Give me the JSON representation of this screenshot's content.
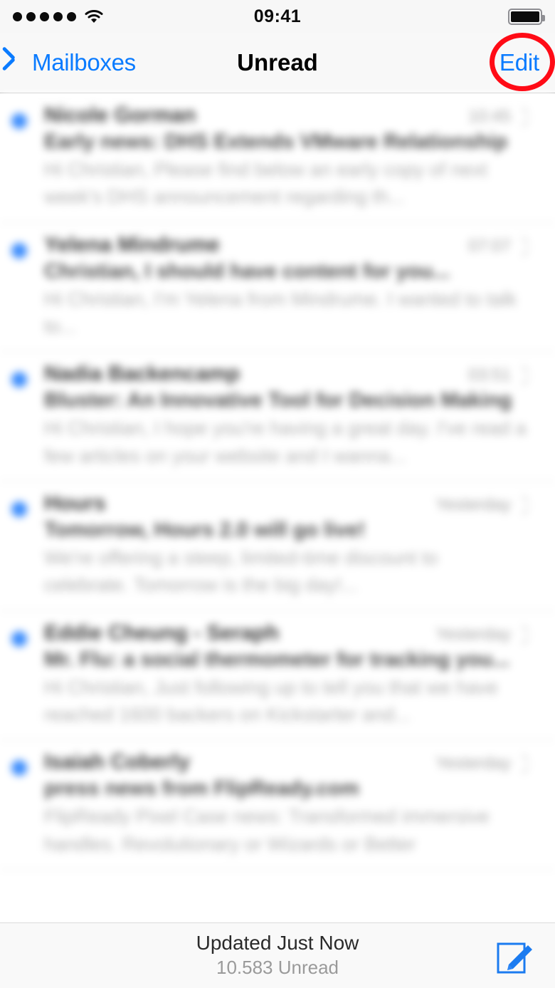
{
  "status_bar": {
    "signal_dots": 5,
    "wifi_icon": "wifi-icon",
    "time": "09:41",
    "battery_icon": "battery-full-icon",
    "battery_level_percent": 100
  },
  "nav_bar": {
    "back_icon": "chevron-left-icon",
    "back_label": "Mailboxes",
    "title": "Unread",
    "edit_label": "Edit",
    "accent_color": "#0a7bff",
    "highlight": {
      "shape": "circle",
      "color": "#ff0b16",
      "target": "edit-button"
    }
  },
  "mail_list": {
    "blurred": true,
    "rows": [
      {
        "unread": true,
        "sender": "Nicole Gorman",
        "timestamp": "10:45",
        "subject": "Early news: DHS Extends VMware Relationship",
        "preview": "Hi Christian, Please find below an early copy of next week's DHS announcement regarding th...",
        "preview_lines": 2
      },
      {
        "unread": true,
        "sender": "Yelena Mindrume",
        "timestamp": "07:07",
        "subject": "Christian, I should have content for you...",
        "preview": "Hi Christian,\nI'm Yelena from Mindrume. I wanted to talk to...",
        "preview_lines": 2
      },
      {
        "unread": true,
        "sender": "Nadia Backencamp",
        "timestamp": "03:51",
        "subject": "Bluster: An Innovative Tool for Decision Making",
        "preview": "Hi Christian, I hope you're having a great day. I've read a few articles on your website and I wanna...",
        "preview_lines": 2
      },
      {
        "unread": true,
        "sender": "Hours",
        "timestamp": "Yesterday",
        "subject": "Tomorrow, Hours 2.0 will go live!",
        "preview": "We're offering a steep, limited-time discount to celebrate. Tomorrow is the big day!...",
        "preview_lines": 2
      },
      {
        "unread": true,
        "sender": "Eddie Cheung - Seraph",
        "timestamp": "Yesterday",
        "subject": "Mr. Flu: a social thermometer for tracking you...",
        "preview": "Hi Christian, Just following up to tell you that we have reached 1600 backers on Kickstarter and...",
        "preview_lines": 2
      },
      {
        "unread": true,
        "sender": "Isaiah Coberly",
        "timestamp": "Yesterday",
        "subject": "press news from FlipReady.com",
        "preview": "FlipReady Pixel Case news: Transformed immersive handles. Revolutionary or Wizards or Better",
        "preview_lines": 2
      }
    ]
  },
  "toolbar": {
    "updated_label": "Updated Just Now",
    "unread_count_label": "10.583 Unread",
    "compose_icon": "compose-icon",
    "compose_color": "#1b7bf0"
  }
}
